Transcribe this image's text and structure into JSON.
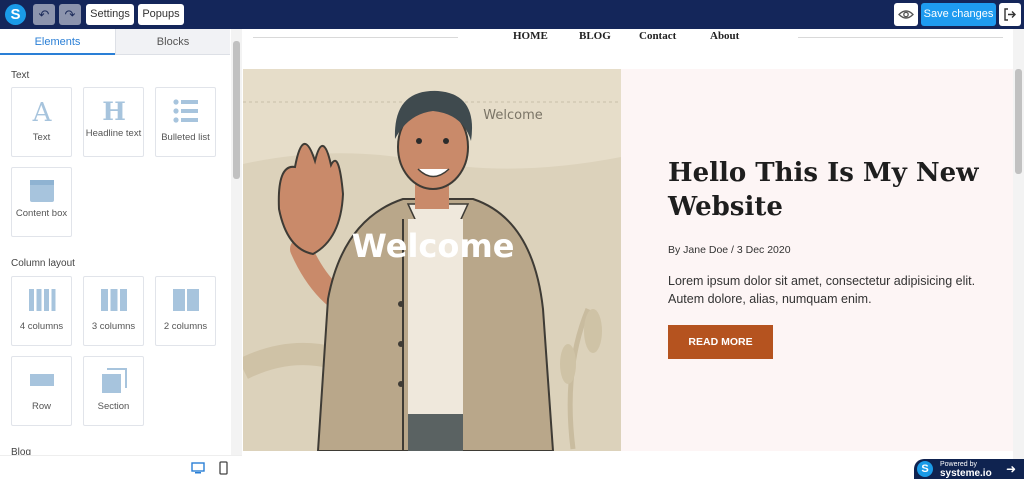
{
  "toolbar": {
    "logo": "S",
    "settings_label": "Settings",
    "popups_label": "Popups",
    "save_label": "Save changes"
  },
  "left_panel": {
    "tabs": [
      {
        "label": "Elements"
      },
      {
        "label": "Blocks"
      }
    ],
    "sections": [
      {
        "title": "Text",
        "items": [
          {
            "label": "Text"
          },
          {
            "label": "Headline text"
          },
          {
            "label": "Bulleted list"
          },
          {
            "label": "Content box"
          }
        ]
      },
      {
        "title": "Column layout",
        "items": [
          {
            "label": "4 columns"
          },
          {
            "label": "3 columns"
          },
          {
            "label": "2 columns"
          },
          {
            "label": "Row"
          },
          {
            "label": "Section"
          }
        ]
      },
      {
        "title": "Blog"
      }
    ]
  },
  "site": {
    "nav": [
      "HOME",
      "BLOG",
      "Contact",
      "About"
    ],
    "hero": {
      "image_caption": "Welcome",
      "image_big_text": "Welcome",
      "title": "Hello This Is My New Website",
      "byline": "By Jane Doe / 3 Dec 2020",
      "description": "Lorem ipsum dolor sit amet, consectetur adipisicing elit. Autem dolore, alias, numquam enim.",
      "button": "READ MORE"
    }
  },
  "powered": {
    "line1": "Powered by",
    "line2": "systeme.io"
  },
  "colors": {
    "topbar": "#14265a",
    "accent": "#1e9bf0",
    "cta": "#b5531f",
    "icon": "#a7c4dd"
  }
}
